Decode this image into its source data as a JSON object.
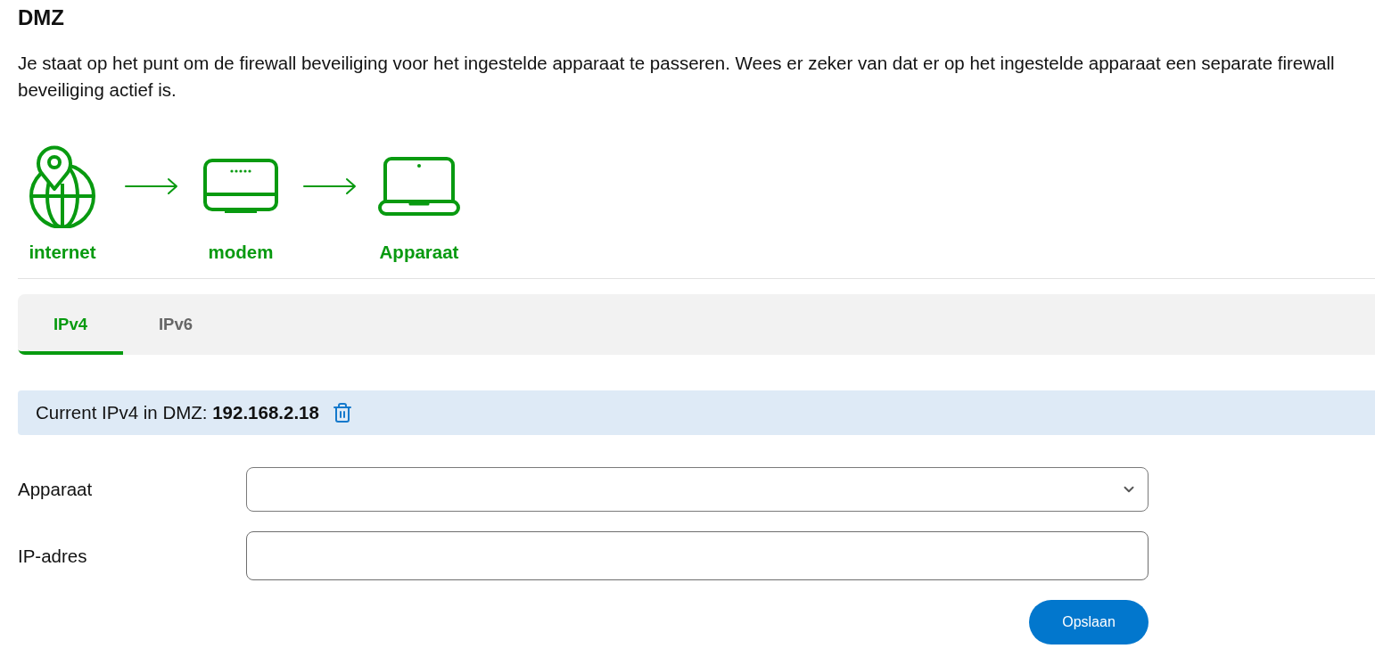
{
  "page": {
    "title": "DMZ",
    "description": "Je staat op het punt om de firewall beveiliging voor het ingestelde apparaat te passeren. Wees er zeker van dat er op het ingestelde apparaat een separate firewall beveiliging actief is."
  },
  "diagram": {
    "nodes": [
      {
        "kind": "globe",
        "label": "internet"
      },
      {
        "kind": "modem",
        "label": "modem"
      },
      {
        "kind": "laptop",
        "label": "Apparaat"
      }
    ]
  },
  "tabs": [
    {
      "label": "IPv4",
      "selected": true
    },
    {
      "label": "IPv6",
      "selected": false
    }
  ],
  "current": {
    "text": "Current IPv4 in DMZ: **192.168.2.18**"
  },
  "form": {
    "fields": [
      {
        "kind": "select",
        "label": "Apparaat"
      },
      {
        "kind": "text",
        "label": "IP-adres"
      }
    ],
    "submit": "Opslaan"
  }
}
